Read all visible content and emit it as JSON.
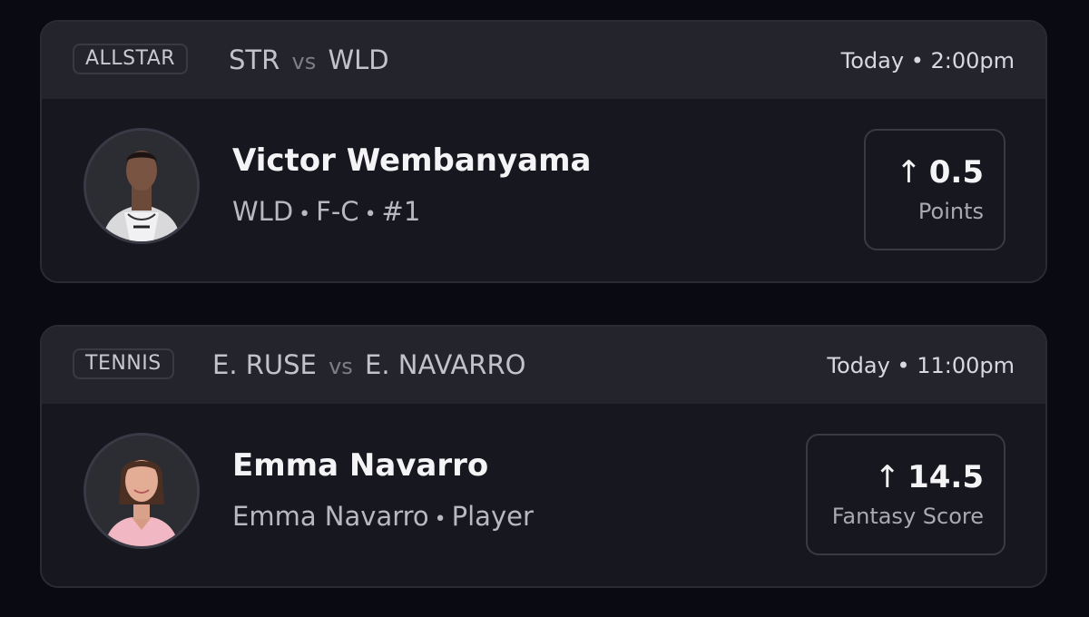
{
  "cards": [
    {
      "sport": "ALLSTAR",
      "team_a": "STR",
      "vs": "vs",
      "team_b": "WLD",
      "time": "Today • 2:00pm",
      "player": {
        "name": "Victor Wembanyama",
        "team": "WLD",
        "position": "F-C",
        "number": "#1"
      },
      "line": {
        "direction_icon": "arrow-up-icon",
        "value": "0.5",
        "stat": "Points"
      }
    },
    {
      "sport": "TENNIS",
      "team_a": "E. RUSE",
      "vs": "vs",
      "team_b": "E. NAVARRO",
      "time": "Today • 11:00pm",
      "player": {
        "name": "Emma Navarro",
        "team": "Emma Navarro",
        "position": "Player"
      },
      "line": {
        "direction_icon": "arrow-up-icon",
        "value": "14.5",
        "stat": "Fantasy Score"
      }
    }
  ]
}
